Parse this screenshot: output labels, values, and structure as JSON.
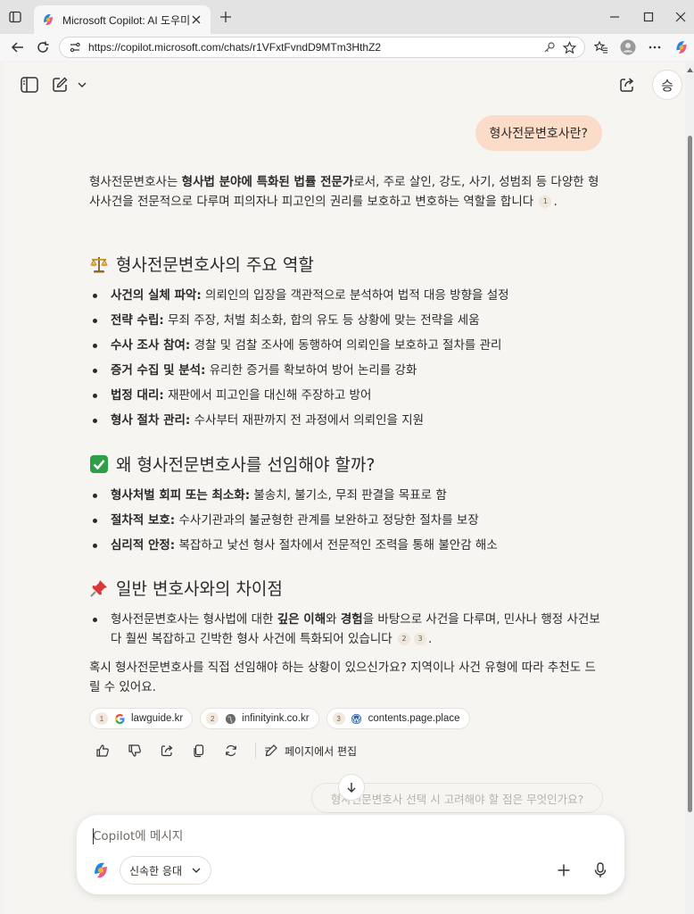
{
  "browser": {
    "tab_title": "Microsoft Copilot: AI 도우미",
    "url": "https://copilot.microsoft.com/chats/r1VFxtFvndD9MTm3HthZ2"
  },
  "header": {
    "avatar_initial": "승"
  },
  "conversation": {
    "user_message": "형사전문변호사란?",
    "intro": {
      "pre": "형사전문변호사는 ",
      "bold": "형사법 분야에 특화된 법률 전문가",
      "post": "로서, 주로 살인, 강도, 사기, 성범죄 등 다양한 형사사건을 전문적으로 다루며 피의자나 피고인의 권리를 보호하고 변호하는 역할을 합니다",
      "cite": "1",
      "end": "."
    },
    "section1": {
      "heading": "형사전문변호사의 주요 역할",
      "items": [
        {
          "bold": "사건의 실체 파악:",
          "text": " 의뢰인의 입장을 객관적으로 분석하여 법적 대응 방향을 설정"
        },
        {
          "bold": "전략 수립:",
          "text": " 무죄 주장, 처벌 최소화, 합의 유도 등 상황에 맞는 전략을 세움"
        },
        {
          "bold": "수사 조사 참여:",
          "text": " 경찰 및 검찰 조사에 동행하여 의뢰인을 보호하고 절차를 관리"
        },
        {
          "bold": "증거 수집 및 분석:",
          "text": " 유리한 증거를 확보하여 방어 논리를 강화"
        },
        {
          "bold": "법정 대리:",
          "text": " 재판에서 피고인을 대신해 주장하고 방어"
        },
        {
          "bold": "형사 절차 관리:",
          "text": " 수사부터 재판까지 전 과정에서 의뢰인을 지원"
        }
      ]
    },
    "section2": {
      "heading": "왜 형사전문변호사를 선임해야 할까?",
      "items": [
        {
          "bold": "형사처벌 회피 또는 최소화:",
          "text": " 불송치, 불기소, 무죄 판결을 목표로 함"
        },
        {
          "bold": "절차적 보호:",
          "text": " 수사기관과의 불균형한 관계를 보완하고 정당한 절차를 보장"
        },
        {
          "bold": "심리적 안정:",
          "text": " 복잡하고 낯선 형사 절차에서 전문적인 조력을 통해 불안감 해소"
        }
      ]
    },
    "section3": {
      "heading": "일반 변호사와의 차이점",
      "item": {
        "pre": "형사전문변호사는 형사법에 대한 ",
        "bold1": "깊은 이해",
        "mid": "와 ",
        "bold2": "경험",
        "post": "을 바탕으로 사건을 다루며, 민사나 행정 사건보다 훨씬 복잡하고 긴박한 형사 사건에 특화되어 있습니다",
        "cite1": "2",
        "cite2": "3",
        "end": "."
      }
    },
    "followup": "혹시 형사전문변호사를 직접 선임해야 하는 상황이 있으신가요? 지역이나 사건 유형에 따라 추천도 드릴 수 있어요.",
    "sources": [
      {
        "num": "1",
        "name": "lawguide.kr",
        "icon": "google-icon"
      },
      {
        "num": "2",
        "name": "infinityink.co.kr",
        "icon": "globe-icon"
      },
      {
        "num": "3",
        "name": "contents.page.place",
        "icon": "wordpress-icon"
      }
    ],
    "edit_label": "페이지에서 편집",
    "suggestion": "형사전문변호사 선택 시 고려해야 할 점은 무엇인가요?"
  },
  "composer": {
    "placeholder": "Copilot에 메시지",
    "mode": "신속한 응대"
  },
  "colors": {
    "user_bubble": "#fbdcc8",
    "page_bg": "#f7f5f2",
    "checkmark_green": "#2e9e47",
    "pushpin_red": "#d9383a"
  }
}
